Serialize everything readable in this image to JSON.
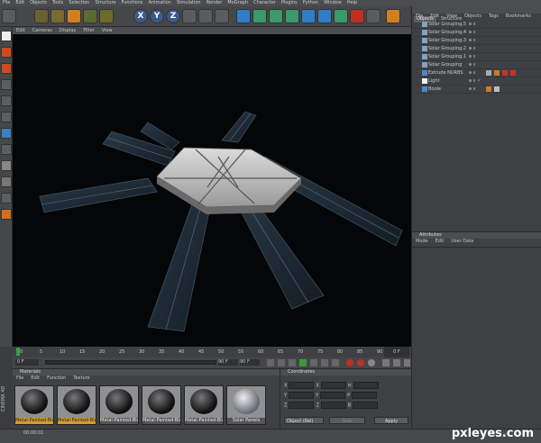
{
  "menubar": [
    "File",
    "Edit",
    "Objects",
    "Tools",
    "Selection",
    "Structure",
    "Functions",
    "Animation",
    "Simulation",
    "Render",
    "MoGraph",
    "Character",
    "Plugins",
    "Python",
    "Window",
    "Help"
  ],
  "toolbar": {
    "axis_x": "X",
    "axis_y": "Y",
    "axis_z": "Z"
  },
  "viewport": {
    "menu": [
      "Edit",
      "Cameras",
      "Display",
      "Filter",
      "View"
    ]
  },
  "timeline": {
    "ticks": [
      "0",
      "5",
      "10",
      "15",
      "20",
      "25",
      "30",
      "35",
      "40",
      "45",
      "50",
      "55",
      "60",
      "65",
      "70",
      "75",
      "80",
      "85",
      "90"
    ],
    "frame_right": "0 F",
    "current": "0 F",
    "end_a": "90 F",
    "end_b": "90 F"
  },
  "object_manager": {
    "tabs": [
      "Objects",
      "Structure"
    ],
    "menu": [
      "File",
      "Edit",
      "View",
      "Objects",
      "Tags",
      "Bookmarks"
    ],
    "rows": [
      {
        "name": "Solar Grouping.5"
      },
      {
        "name": "Solar Grouping.4"
      },
      {
        "name": "Solar Grouping.3"
      },
      {
        "name": "Solar Grouping.2"
      },
      {
        "name": "Solar Grouping.1"
      },
      {
        "name": "Solar Grouping"
      },
      {
        "name": "Extrude NURBS"
      },
      {
        "name": "Light"
      },
      {
        "name": "Boole"
      }
    ]
  },
  "attributes": {
    "title": "Attributes",
    "menu": [
      "Mode",
      "Edit",
      "User Data"
    ]
  },
  "materials": {
    "title": "Materials",
    "menu": [
      "File",
      "Edit",
      "Function",
      "Texture"
    ],
    "items": [
      {
        "label": "Metal-Painted-Bla",
        "selected": true
      },
      {
        "label": "Metal-Painted-Bla",
        "selected": true
      },
      {
        "label": "Metal-Painted-Bla",
        "selected": false
      },
      {
        "label": "Metal-Painted-Bla",
        "selected": false
      },
      {
        "label": "Metal-Painted-Bla",
        "selected": false
      },
      {
        "label": "Solar Panels",
        "selected": false
      }
    ]
  },
  "coordinates": {
    "title": "Coordinates",
    "rows": [
      {
        "a": "X",
        "b": "X",
        "c": "H"
      },
      {
        "a": "Y",
        "b": "Y",
        "c": "P"
      },
      {
        "a": "Z",
        "b": "Z",
        "c": "B"
      }
    ],
    "mode": "Object (Rel)",
    "size": "Size",
    "apply": "Apply"
  },
  "statusbar": {
    "time": "00:00:01",
    "watermark": "pxleyes.com",
    "vertical": "CINEMA 4D"
  }
}
